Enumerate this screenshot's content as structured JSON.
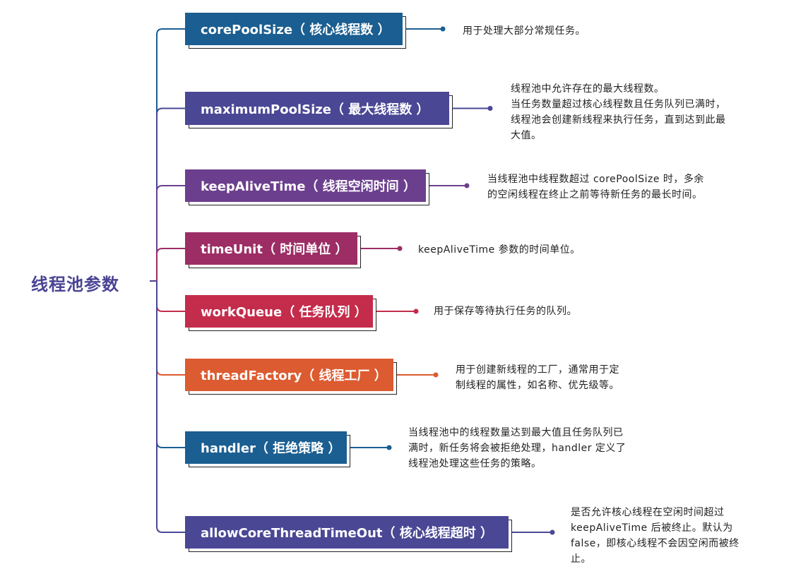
{
  "root": {
    "label": "线程池参数"
  },
  "params": [
    {
      "label": "corePoolSize（ 核心线程数 ）",
      "color": "#1b5e91",
      "description": "用于处理大部分常规任务。"
    },
    {
      "label": "maximumPoolSize（ 最大线程数 ）",
      "color": "#4a4795",
      "description": "线程池中允许存在的最大线程数。\n当任务数量超过核心线程数且任务队列已满时，\n线程池会创建新线程来执行任务，直到达到此最\n大值。"
    },
    {
      "label": "keepAliveTime（ 线程空闲时间 ）",
      "color": "#6c3f8e",
      "description": "当线程池中线程数超过 corePoolSize 时，多余\n的空闲线程在终止之前等待新任务的最长时间。"
    },
    {
      "label": "timeUnit（ 时间单位 ）",
      "color": "#9c2d65",
      "description": "keepAliveTime 参数的时间单位。"
    },
    {
      "label": "workQueue（ 任务队列 ）",
      "color": "#c42c4b",
      "description": "用于保存等待执行任务的队列。"
    },
    {
      "label": "threadFactory（ 线程工厂 ）",
      "color": "#dc5b30",
      "description": "用于创建新线程的工厂，通常用于定\n制线程的属性，如名称、优先级等。"
    },
    {
      "label": "handler（ 拒绝策略 ）",
      "color": "#1b5e91",
      "description": "当线程池中的线程数量达到最大值且任务队列已\n满时，新任务将会被拒绝处理，handler 定义了\n线程池处理这些任务的策略。"
    },
    {
      "label": "allowCoreThreadTimeOut（ 核心线程超时 ）",
      "color": "#4a4795",
      "description": "是否允许核心线程在空闲时间超过\nkeepAliveTime 后被终止。默认为\nfalse，即核心线程不会因空闲而被终\n止。"
    }
  ]
}
